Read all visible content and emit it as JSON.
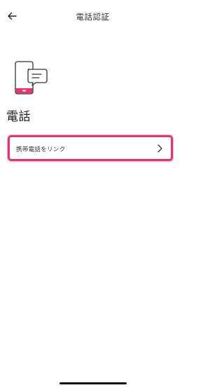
{
  "header": {
    "title": "電話認証",
    "back_icon": "arrow-left-icon"
  },
  "illustration": {
    "icon": "phone-with-chat-icon",
    "accent_color": "#e8336d"
  },
  "section": {
    "title": "電話"
  },
  "link_row": {
    "label": "携帯電話をリンク",
    "chevron_icon": "chevron-right-icon",
    "highlight_color": "#e8336d"
  }
}
